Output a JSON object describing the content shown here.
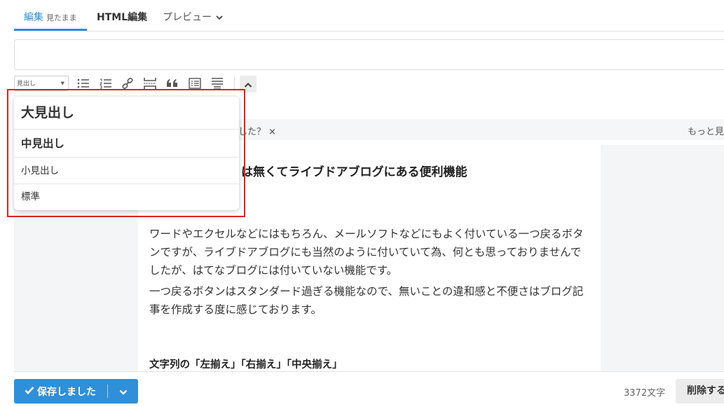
{
  "tabs": {
    "edit_label": "編集",
    "edit_sub": "見たまま",
    "html_label": "HTML編集",
    "preview_label": "プレビュー"
  },
  "title_input": {
    "value": ""
  },
  "toolbar": {
    "heading_select_value": "見出し",
    "icons": [
      "unordered-list-icon",
      "ordered-list-icon",
      "link-icon",
      "more-separator-icon",
      "blockquote-icon",
      "list-box-icon",
      "text-wrap-icon",
      "collapse-up-icon"
    ]
  },
  "notice": {
    "question": "した？",
    "close": "×",
    "more": "もっと見"
  },
  "article": {
    "heading": "は無くてライブドアブログにある便利機能",
    "paragraph1": "ワードやエクセルなどにはもちろん、メールソフトなどにもよく付いている一つ戻るボタンですが、ライブドアブログにも当然のように付いていて為、何とも思っておりませんでしたが、はてなブログには付いていない機能です。",
    "paragraph2": "一つ戻るボタンはスタンダード過ぎる機能なので、無いことの違和感と不便さはブログ記事を作成する度に感じております。",
    "subheading": "文字列の「左揃え」「右揃え」「中央揃え」"
  },
  "heading_dropdown": {
    "options": [
      "大見出し",
      "中見出し",
      "小見出し",
      "標準"
    ]
  },
  "footer": {
    "save_label": "保存しました",
    "char_count": "3372文字",
    "delete_label": "削除する"
  },
  "colors": {
    "accent": "#2f8fd8",
    "highlight": "#e02020"
  }
}
